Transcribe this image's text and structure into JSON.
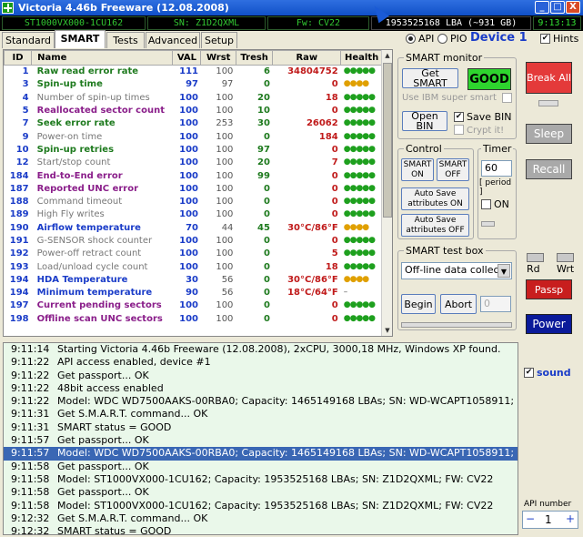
{
  "window": {
    "title": "Victoria 4.46b Freeware (12.08.2008)",
    "min": "_",
    "max": "□",
    "close": "X"
  },
  "infobar": {
    "model": "ST1000VX000-1CU162",
    "serial": "SN: Z1D2QXML",
    "firmware": "Fw: CV22",
    "lba": "1953525168 LBA (~931 GB)",
    "clock": "9:13:13"
  },
  "tabs": [
    "Standard",
    "SMART",
    "Tests",
    "Advanced",
    "Setup"
  ],
  "api": {
    "api_label": "API",
    "pio_label": "PIO",
    "device": "Device 1",
    "hints": "Hints"
  },
  "columns": [
    "ID",
    "Name",
    "VAL",
    "Wrst",
    "Tresh",
    "Raw",
    "Health"
  ],
  "rows": [
    {
      "id": "1",
      "name": "Raw read error rate",
      "val": "111",
      "wrst": "100",
      "tresh": "6",
      "raw": "34804752",
      "health": "●●●●●",
      "nc": "#1e7a1e",
      "hc": "#1ea01e"
    },
    {
      "id": "3",
      "name": "Spin-up time",
      "val": "97",
      "wrst": "97",
      "tresh": "0",
      "raw": "0",
      "health": "●●●●",
      "nc": "#1e7a1e",
      "hc": "#e0a000"
    },
    {
      "id": "4",
      "name": "Number of spin-up times",
      "val": "100",
      "wrst": "100",
      "tresh": "20",
      "raw": "18",
      "health": "●●●●●",
      "nc": "#777777",
      "hc": "#1ea01e"
    },
    {
      "id": "5",
      "name": "Reallocated sector count",
      "val": "100",
      "wrst": "100",
      "tresh": "10",
      "raw": "0",
      "health": "●●●●●",
      "nc": "#8a1e8a",
      "hc": "#1ea01e"
    },
    {
      "id": "7",
      "name": "Seek error rate",
      "val": "100",
      "wrst": "253",
      "tresh": "30",
      "raw": "26062",
      "health": "●●●●●",
      "nc": "#1e7a1e",
      "hc": "#1ea01e"
    },
    {
      "id": "9",
      "name": "Power-on time",
      "val": "100",
      "wrst": "100",
      "tresh": "0",
      "raw": "184",
      "health": "●●●●●",
      "nc": "#777777",
      "hc": "#1ea01e"
    },
    {
      "id": "10",
      "name": "Spin-up retries",
      "val": "100",
      "wrst": "100",
      "tresh": "97",
      "raw": "0",
      "health": "●●●●●",
      "nc": "#1e7a1e",
      "hc": "#1ea01e"
    },
    {
      "id": "12",
      "name": "Start/stop count",
      "val": "100",
      "wrst": "100",
      "tresh": "20",
      "raw": "7",
      "health": "●●●●●",
      "nc": "#777777",
      "hc": "#1ea01e"
    },
    {
      "id": "184",
      "name": "End-to-End error",
      "val": "100",
      "wrst": "100",
      "tresh": "99",
      "raw": "0",
      "health": "●●●●●",
      "nc": "#8a1e8a",
      "hc": "#1ea01e"
    },
    {
      "id": "187",
      "name": "Reported UNC error",
      "val": "100",
      "wrst": "100",
      "tresh": "0",
      "raw": "0",
      "health": "●●●●●",
      "nc": "#8a1e8a",
      "hc": "#1ea01e"
    },
    {
      "id": "188",
      "name": "Command timeout",
      "val": "100",
      "wrst": "100",
      "tresh": "0",
      "raw": "0",
      "health": "●●●●●",
      "nc": "#777777",
      "hc": "#1ea01e"
    },
    {
      "id": "189",
      "name": "High Fly writes",
      "val": "100",
      "wrst": "100",
      "tresh": "0",
      "raw": "0",
      "health": "●●●●●",
      "nc": "#777777",
      "hc": "#1ea01e"
    },
    {
      "id": "190",
      "name": "Airflow temperature",
      "val": "70",
      "wrst": "44",
      "tresh": "45",
      "raw": "30°C/86°F",
      "health": "●●●●",
      "nc": "#1a3cc8",
      "hc": "#e0a000"
    },
    {
      "id": "191",
      "name": "G-SENSOR shock counter",
      "val": "100",
      "wrst": "100",
      "tresh": "0",
      "raw": "0",
      "health": "●●●●●",
      "nc": "#777777",
      "hc": "#1ea01e"
    },
    {
      "id": "192",
      "name": "Power-off retract count",
      "val": "100",
      "wrst": "100",
      "tresh": "0",
      "raw": "5",
      "health": "●●●●●",
      "nc": "#777777",
      "hc": "#1ea01e"
    },
    {
      "id": "193",
      "name": "Load/unload cycle count",
      "val": "100",
      "wrst": "100",
      "tresh": "0",
      "raw": "18",
      "health": "●●●●●",
      "nc": "#777777",
      "hc": "#1ea01e"
    },
    {
      "id": "194",
      "name": "HDA Temperature",
      "val": "30",
      "wrst": "56",
      "tresh": "0",
      "raw": "30°C/86°F",
      "health": "●●●●",
      "nc": "#1a3cc8",
      "hc": "#e0a000"
    },
    {
      "id": "194",
      "name": "Minimum temperature",
      "val": "90",
      "wrst": "56",
      "tresh": "0",
      "raw": "18°C/64°F",
      "health": "–",
      "nc": "#1a3cc8",
      "hc": "#555555"
    },
    {
      "id": "197",
      "name": "Current pending sectors",
      "val": "100",
      "wrst": "100",
      "tresh": "0",
      "raw": "0",
      "health": "●●●●●",
      "nc": "#8a1e8a",
      "hc": "#1ea01e"
    },
    {
      "id": "198",
      "name": "Offline scan UNC sectors",
      "val": "100",
      "wrst": "100",
      "tresh": "0",
      "raw": "0",
      "health": "●●●●●",
      "nc": "#8a1e8a",
      "hc": "#1ea01e"
    }
  ],
  "smart_monitor": {
    "label": "SMART monitor",
    "get_smart": "Get SMART",
    "status": "GOOD",
    "ibm": "Use IBM super smart",
    "open_bin": "Open BIN",
    "save_bin": "Save BIN",
    "crypt": "Crypt it!"
  },
  "control": {
    "label": "Control",
    "smart_on": "SMART ON",
    "smart_off": "SMART OFF",
    "autosave_on": "Auto Save attributes ON",
    "autosave_off": "Auto Save attributes OFF"
  },
  "timer": {
    "label": "Timer",
    "value": "60",
    "period": "[ period ]",
    "on": "ON"
  },
  "testbox": {
    "label": "SMART test box",
    "select": "Off-line data collect",
    "begin": "Begin",
    "abort": "Abort",
    "number": "0"
  },
  "side": {
    "break_all": "Break All",
    "sleep": "Sleep",
    "recall": "Recall",
    "rd": "Rd",
    "wrt": "Wrt",
    "passp": "Passp",
    "power": "Power",
    "sound": "sound",
    "api_number_label": "API number",
    "api_number": "1",
    "minus": "−",
    "plus": "+"
  },
  "log": [
    {
      "t": "9:11:14",
      "m": "Starting Victoria 4.46b Freeware (12.08.2008), 2xCPU, 3000,18 MHz, Windows XP found."
    },
    {
      "t": "9:11:22",
      "m": "API access enabled, device #1"
    },
    {
      "t": "9:11:22",
      "m": "Get passport... OK"
    },
    {
      "t": "9:11:22",
      "m": "48bit access enabled"
    },
    {
      "t": "9:11:22",
      "m": "Model: WDC WD7500AAKS-00RBA0; Capacity: 1465149168 LBAs; SN: WD-WCAPT1058911; FW: ..."
    },
    {
      "t": "9:11:31",
      "m": "Get S.M.A.R.T. command... OK"
    },
    {
      "t": "9:11:31",
      "m": "SMART status = GOOD"
    },
    {
      "t": "9:11:57",
      "m": "Get passport... OK"
    },
    {
      "t": "9:11:57",
      "m": "Model: WDC WD7500AAKS-00RBA0; Capacity: 1465149168 LBAs; SN: WD-WCAPT1058911; FW: ..."
    },
    {
      "t": "9:11:58",
      "m": "Get passport... OK"
    },
    {
      "t": "9:11:58",
      "m": "Model: ST1000VX000-1CU162; Capacity: 1953525168 LBAs; SN: Z1D2QXML; FW: CV22"
    },
    {
      "t": "9:11:58",
      "m": "Get passport... OK"
    },
    {
      "t": "9:11:58",
      "m": "Model: ST1000VX000-1CU162; Capacity: 1953525168 LBAs; SN: Z1D2QXML; FW: CV22"
    },
    {
      "t": "9:12:32",
      "m": "Get S.M.A.R.T. command... OK"
    },
    {
      "t": "9:12:32",
      "m": "SMART status = GOOD"
    }
  ],
  "selected_log_index": 8
}
